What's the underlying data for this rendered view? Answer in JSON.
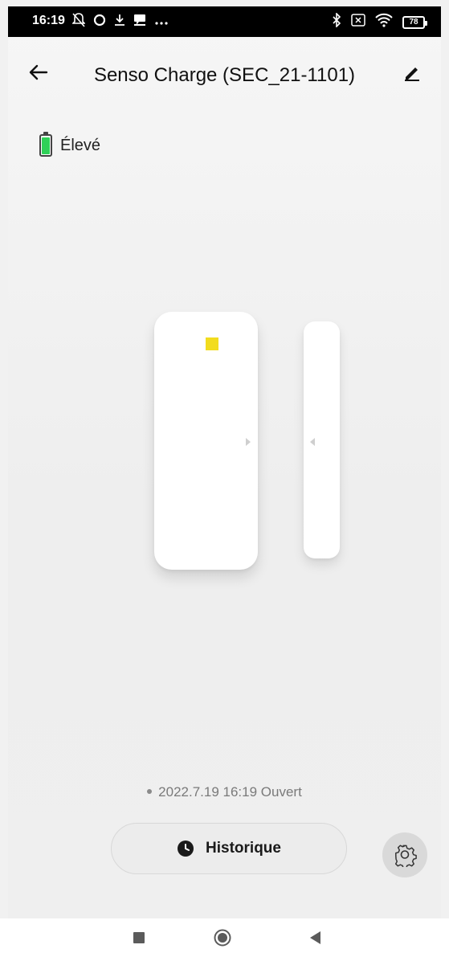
{
  "status_bar": {
    "time": "16:19",
    "battery_level": "78",
    "left_icons": [
      "bell-off-icon",
      "circle-icon",
      "download-icon",
      "chat-icon",
      "more-icon"
    ],
    "right_icons": [
      "bluetooth-icon",
      "sim-x-icon",
      "wifi-icon",
      "battery-icon"
    ]
  },
  "header": {
    "title": "Senso Charge (SEC_21-1101)"
  },
  "battery_indicator": {
    "label": "Élevé",
    "fill_fraction": 0.9,
    "color": "#2fd158"
  },
  "sensor": {
    "led_color": "#f2dc1e"
  },
  "event": {
    "text": "2022.7.19 16:19 Ouvert"
  },
  "actions": {
    "history_label": "Historique"
  },
  "colors": {
    "background": "#f1f1f1",
    "status_bar": "#000000",
    "button_bg": "#ececec",
    "settings_bg": "#d9d9d9"
  }
}
